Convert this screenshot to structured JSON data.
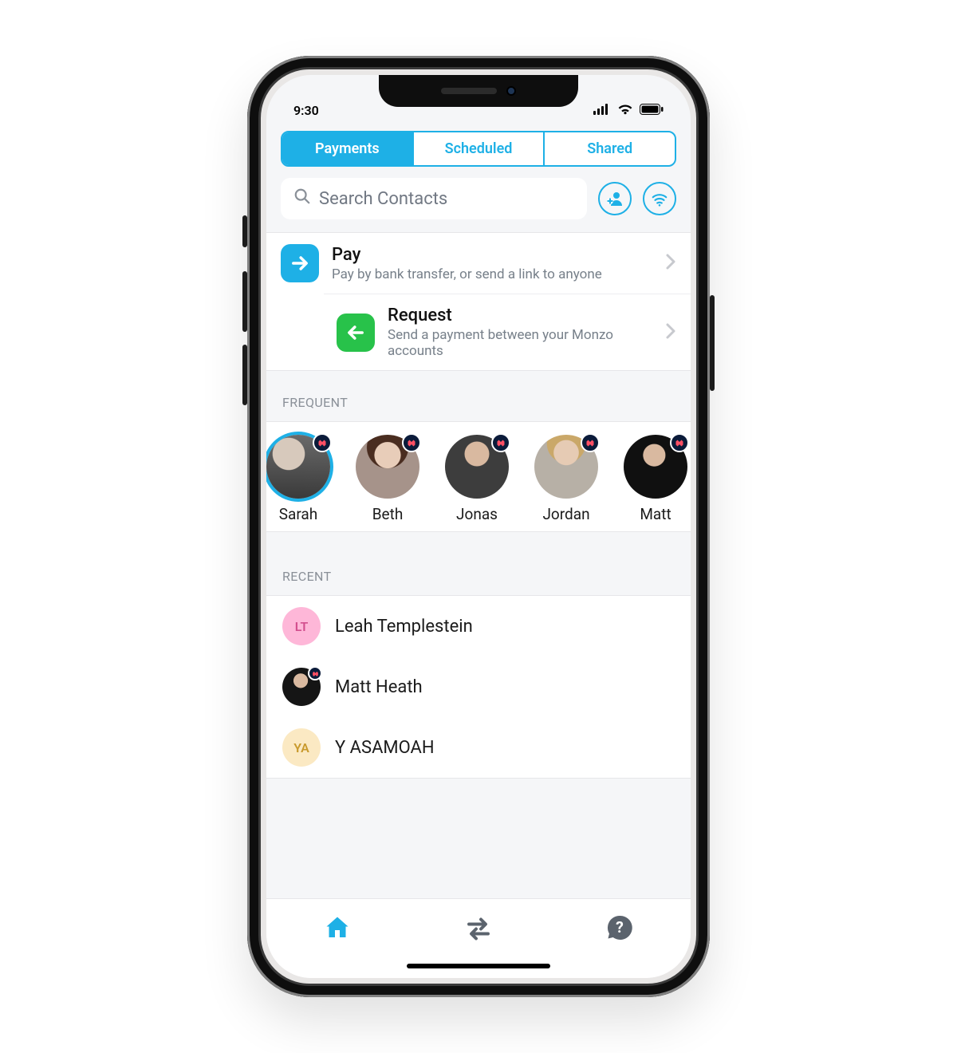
{
  "status": {
    "time": "9:30"
  },
  "tabs": [
    {
      "label": "Payments",
      "active": true
    },
    {
      "label": "Scheduled",
      "active": false
    },
    {
      "label": "Shared",
      "active": false
    }
  ],
  "search": {
    "placeholder": "Search Contacts"
  },
  "actions": {
    "pay": {
      "title": "Pay",
      "subtitle": "Pay by bank transfer, or send a link to anyone"
    },
    "request": {
      "title": "Request",
      "subtitle": "Send a payment between your Monzo accounts"
    }
  },
  "sections": {
    "frequent": "FREQUENT",
    "recent": "RECENT"
  },
  "frequent": [
    {
      "name": "Sarah",
      "badge": true,
      "active": true
    },
    {
      "name": "Beth",
      "badge": true,
      "active": false
    },
    {
      "name": "Jonas",
      "badge": true,
      "active": false
    },
    {
      "name": "Jordan",
      "badge": true,
      "active": false
    },
    {
      "name": "Matt",
      "badge": true,
      "active": false
    }
  ],
  "recent": [
    {
      "name": "Leah Templestein",
      "initials": "LT",
      "color": "pink",
      "badge": false
    },
    {
      "name": "Matt Heath",
      "initials": "",
      "color": "photo",
      "badge": true
    },
    {
      "name": "Y ASAMOAH",
      "initials": "YA",
      "color": "cream",
      "badge": false
    }
  ],
  "colors": {
    "accent": "#1eb0e6",
    "green": "#28c24a"
  }
}
